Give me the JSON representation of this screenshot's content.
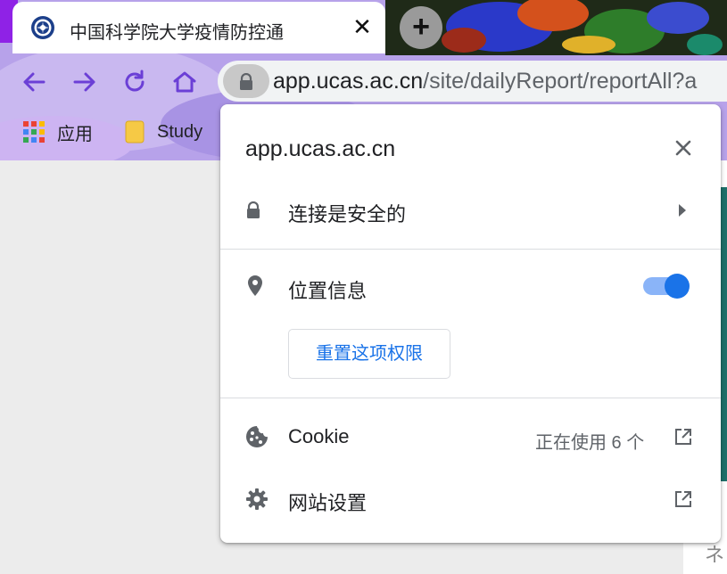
{
  "browser": {
    "tab": {
      "title": "中国科学院大学疫情防控通",
      "favicon": "ucas-emblem-icon",
      "close_glyph": "✕"
    },
    "new_tab_glyph": "+",
    "nav": {
      "back": "arrow-left-icon",
      "forward": "arrow-right-icon",
      "reload": "reload-icon",
      "home": "home-icon"
    },
    "omnibox": {
      "host": "app.ucas.ac.cn",
      "path": "/site/dailyReport/reportAll?a"
    },
    "bookmarks": [
      {
        "label": "应用",
        "icon": "apps-grid-icon"
      },
      {
        "label": "Study",
        "icon": "folder-icon"
      }
    ],
    "side_text": "ネ"
  },
  "popup": {
    "title": "app.ucas.ac.cn",
    "connection": {
      "label": "连接是安全的",
      "icon": "lock-icon"
    },
    "location": {
      "label": "位置信息",
      "icon": "location-pin-icon",
      "enabled": true
    },
    "reset_button": "重置这项权限",
    "cookie": {
      "label": "Cookie",
      "status": "正在使用 6 个",
      "icon": "cookie-icon"
    },
    "site_settings": {
      "label": "网站设置",
      "icon": "gear-icon"
    }
  },
  "colors": {
    "accent": "#1a73e8",
    "nav_icon": "#6b3fd6",
    "theme": "#b39be8"
  }
}
